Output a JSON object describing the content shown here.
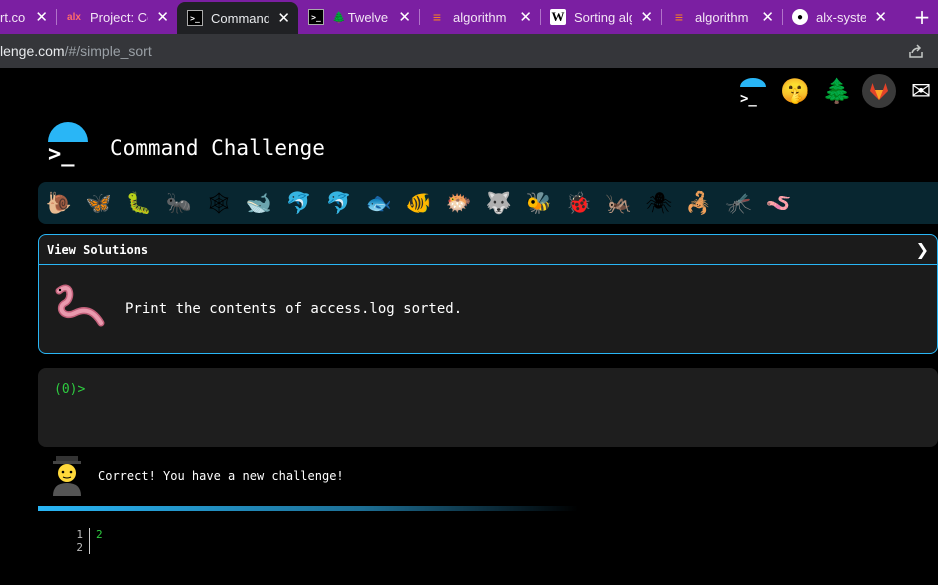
{
  "browser": {
    "tabs": [
      {
        "title": "rt.co",
        "favicon": "generic-icon",
        "active": false
      },
      {
        "title": "Project: Co",
        "favicon": "alx-icon",
        "active": false
      },
      {
        "title": "Command",
        "favicon": "terminal-icon",
        "active": true
      },
      {
        "title": "Twelve",
        "favicon": "terminal-tree-icon",
        "active": false
      },
      {
        "title": "algorithm",
        "favicon": "stackoverflow-icon",
        "active": false
      },
      {
        "title": "Sorting alg",
        "favicon": "wikipedia-icon",
        "active": false
      },
      {
        "title": "algorithm",
        "favicon": "stackoverflow-icon",
        "active": false
      },
      {
        "title": "alx-system",
        "favicon": "github-icon",
        "active": false
      }
    ],
    "url_host": "lenge.com",
    "url_path": "/#/simple_sort",
    "accent_color": "#7b1fa2"
  },
  "header": {
    "title": "Command Challenge",
    "icons": [
      "terminal-logo-icon",
      "shushing-face-icon",
      "tree-icon",
      "gitlab-icon",
      "envelope-icon"
    ]
  },
  "creatures": [
    "🐌",
    "🦋",
    "🐛",
    "🐜",
    "🕸",
    "🐋",
    "🐬",
    "🐬",
    "🐟",
    "🐠",
    "🐡",
    "🐺",
    "🐝",
    "🐞",
    "🦗",
    "🕷",
    "🦂",
    "🦟",
    "🪱"
  ],
  "challenge": {
    "view_solutions": "View Solutions",
    "chevron": "❯",
    "description": "Print the contents of access.log sorted."
  },
  "terminal": {
    "prompt": "(0)>"
  },
  "result": {
    "message": "Correct! You have a new challenge!"
  },
  "output": {
    "lines": [
      {
        "num": "1",
        "text": "2"
      },
      {
        "num": "2",
        "text": ""
      }
    ]
  },
  "colors": {
    "accent": "#29b6f6",
    "prompt": "#2ecc40",
    "panel": "#1b1b1b"
  }
}
